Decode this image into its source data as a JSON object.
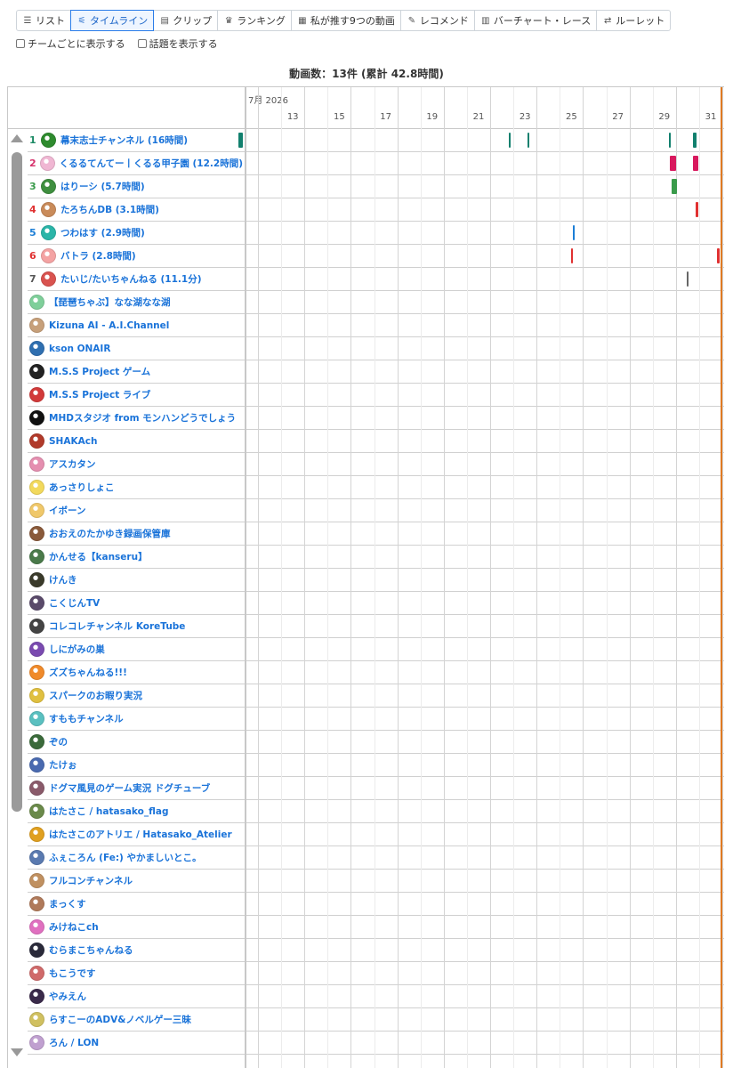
{
  "tabs": [
    {
      "label": "リスト",
      "icon": "list-icon",
      "glyph": "☰"
    },
    {
      "label": "タイムライン",
      "icon": "sliders-icon",
      "glyph": "⚟",
      "active": true
    },
    {
      "label": "クリップ",
      "icon": "film-icon",
      "glyph": "▤"
    },
    {
      "label": "ランキング",
      "icon": "trophy-icon",
      "glyph": "♛"
    },
    {
      "label": "私が推す9つの動画",
      "icon": "grid-icon",
      "glyph": "▦"
    },
    {
      "label": "レコメンド",
      "icon": "wand-icon",
      "glyph": "✎"
    },
    {
      "label": "バーチャート・レース",
      "icon": "bar-chart-icon",
      "glyph": "▥"
    },
    {
      "label": "ルーレット",
      "icon": "shuffle-icon",
      "glyph": "⇄"
    }
  ],
  "options": {
    "team_label": "チームごとに表示する",
    "topic_label": "話題を表示する",
    "team_checked": false,
    "topic_checked": false
  },
  "summary": "動画数：13件 (累計 42.8時間)",
  "timeline": {
    "month_label": "7月 2026",
    "day_ticks": [
      "13",
      "15",
      "17",
      "19",
      "21",
      "23",
      "25",
      "27",
      "29",
      "31"
    ],
    "colors": {
      "now_line": "#e07a22",
      "link": "#1a73d9",
      "grid": "#dddddd"
    }
  },
  "channels": [
    {
      "rank": "1",
      "name": "幕末志士チャンネル (16時間)",
      "rank_color": "#1b8a64",
      "avatar_color": "#2e8b2e",
      "bar_color": "#12806e",
      "sessions": [
        [
          11.15,
          11.35
        ],
        [
          22.8,
          22.85
        ],
        [
          23.6,
          23.7
        ],
        [
          29.7,
          29.77
        ],
        [
          30.75,
          30.9
        ]
      ]
    },
    {
      "rank": "2",
      "name": "くるるてんてー丨くるる甲子園 (12.2時間)",
      "rank_color": "#d6336c",
      "avatar_color": "#f0b7d3",
      "bar_color": "#d8195e",
      "sessions": [
        [
          29.75,
          30.0
        ],
        [
          30.75,
          30.95
        ]
      ]
    },
    {
      "rank": "3",
      "name": "はりーシ (5.7時間)",
      "rank_color": "#3a9b4b",
      "avatar_color": "#3f8f3f",
      "bar_color": "#3a9b4b",
      "sessions": [
        [
          29.8,
          30.05
        ]
      ]
    },
    {
      "rank": "4",
      "name": "たろちんDB (3.1時間)",
      "rank_color": "#e03131",
      "avatar_color": "#c98b5a",
      "bar_color": "#e03131",
      "sessions": [
        [
          30.85,
          30.95
        ]
      ]
    },
    {
      "rank": "5",
      "name": "つわはす (2.9時間)",
      "rank_color": "#1c7ed6",
      "avatar_color": "#2bb5a8",
      "bar_color": "#1c7ed6",
      "sessions": [
        [
          25.55,
          25.65
        ]
      ]
    },
    {
      "rank": "6",
      "name": "バトラ (2.8時間)",
      "rank_color": "#e03131",
      "avatar_color": "#f4a3a3",
      "bar_color": "#e03131",
      "sessions": [
        [
          25.48,
          25.52
        ],
        [
          31.75,
          31.9
        ]
      ]
    },
    {
      "rank": "7",
      "name": "たいじ/たいちゃんねる (11.1分)",
      "rank_color": "#555555",
      "avatar_color": "#d9534f",
      "bar_color": "#666666",
      "sessions": [
        [
          30.45,
          30.5
        ]
      ]
    },
    {
      "rank": "",
      "name": "【琵琶ちゃぶ】なな湖なな湖",
      "avatar_color": "#7fcf9a"
    },
    {
      "rank": "",
      "name": "Kizuna AI - A.I.Channel",
      "avatar_color": "#c7a07a"
    },
    {
      "rank": "",
      "name": "kson ONAIR",
      "avatar_color": "#2f6fb0"
    },
    {
      "rank": "",
      "name": "M.S.S Project ゲーム",
      "avatar_color": "#222222"
    },
    {
      "rank": "",
      "name": "M.S.S Project ライブ",
      "avatar_color": "#d23a3a"
    },
    {
      "rank": "",
      "name": "MHDスタジオ from モンハンどうでしょう",
      "avatar_color": "#111111"
    },
    {
      "rank": "",
      "name": "SHAKAch",
      "avatar_color": "#b13a2a"
    },
    {
      "rank": "",
      "name": "アスカタン",
      "avatar_color": "#e58fb0"
    },
    {
      "rank": "",
      "name": "あっさりしょこ",
      "avatar_color": "#f2d95c"
    },
    {
      "rank": "",
      "name": "イボーン",
      "avatar_color": "#f0c86a"
    },
    {
      "rank": "",
      "name": "おおえのたかゆき録画保管庫",
      "avatar_color": "#8a5a3a"
    },
    {
      "rank": "",
      "name": "かんせる【kanseru】",
      "avatar_color": "#4a7a4a"
    },
    {
      "rank": "",
      "name": "けんき",
      "avatar_color": "#3a3a2a"
    },
    {
      "rank": "",
      "name": "こくじんTV",
      "avatar_color": "#5a4a6a"
    },
    {
      "rank": "",
      "name": "コレコレチャンネル KoreTube",
      "avatar_color": "#444444"
    },
    {
      "rank": "",
      "name": "しにがみの巣",
      "avatar_color": "#7a4ab0"
    },
    {
      "rank": "",
      "name": "ズズちゃんねる!!!",
      "avatar_color": "#f08a2a"
    },
    {
      "rank": "",
      "name": "スパークのお暇り実況",
      "avatar_color": "#e0c040"
    },
    {
      "rank": "",
      "name": "すももチャンネル",
      "avatar_color": "#5ac0c0"
    },
    {
      "rank": "",
      "name": "ぞの",
      "avatar_color": "#3a6a3a"
    },
    {
      "rank": "",
      "name": "たけぉ",
      "avatar_color": "#4a6ab0"
    },
    {
      "rank": "",
      "name": "ドグマ風見のゲーム実況 ドグチューブ",
      "avatar_color": "#8a5a6a"
    },
    {
      "rank": "",
      "name": "はたさこ / hatasako_flag",
      "avatar_color": "#6a8a4a"
    },
    {
      "rank": "",
      "name": "はたさこのアトリエ / Hatasako_Atelier",
      "avatar_color": "#e0a020"
    },
    {
      "rank": "",
      "name": "ふぇころん (Fe:) やかましいとこ。",
      "avatar_color": "#5a7ab0"
    },
    {
      "rank": "",
      "name": "フルコンチャンネル",
      "avatar_color": "#c09060"
    },
    {
      "rank": "",
      "name": "まっくす",
      "avatar_color": "#b07a5a"
    },
    {
      "rank": "",
      "name": "みけねこch",
      "avatar_color": "#e070c0"
    },
    {
      "rank": "",
      "name": "むらまこちゃんねる",
      "avatar_color": "#2a2a3a"
    },
    {
      "rank": "",
      "name": "もこうです",
      "avatar_color": "#d06a6a"
    },
    {
      "rank": "",
      "name": "やみえん",
      "avatar_color": "#3a2a4a"
    },
    {
      "rank": "",
      "name": "らすこーのADV&ノベルゲー三昧",
      "avatar_color": "#d0c060"
    },
    {
      "rank": "",
      "name": "ろん / LON",
      "avatar_color": "#c0a0d0"
    }
  ]
}
